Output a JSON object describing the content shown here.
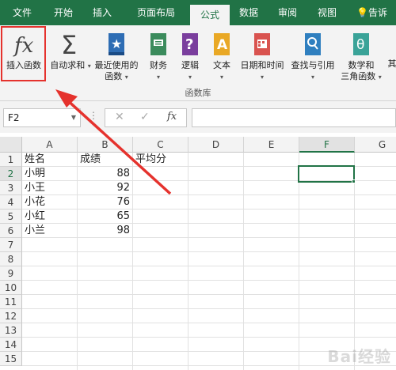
{
  "tabs": [
    {
      "label": "文件"
    },
    {
      "label": "开始"
    },
    {
      "label": "插入"
    },
    {
      "label": "页面布局"
    },
    {
      "label": "公式",
      "active": true
    },
    {
      "label": "数据"
    },
    {
      "label": "审阅"
    },
    {
      "label": "视图"
    },
    {
      "label": "告诉我"
    }
  ],
  "ribbon": {
    "insert_function": {
      "icon": "function-fx-icon",
      "label": "插入函数"
    },
    "autosum": {
      "icon": "sigma-icon",
      "label": "自动求和"
    },
    "recent": {
      "icon": "star-book-icon",
      "label1": "最近使用的",
      "label2": "函数"
    },
    "finance": {
      "icon": "finance-book-icon",
      "label": "财务"
    },
    "logic": {
      "icon": "question-book-icon",
      "label": "逻辑"
    },
    "text": {
      "icon": "text-book-icon",
      "label": "文本"
    },
    "datetime": {
      "icon": "calendar-book-icon",
      "label": "日期和时间"
    },
    "lookup": {
      "icon": "search-book-icon",
      "label": "查找与引用"
    },
    "math": {
      "icon": "theta-book-icon",
      "label1": "数学和",
      "label2": "三角函数"
    },
    "more": {
      "label": "其"
    },
    "group_label": "函数库"
  },
  "formula_bar": {
    "name_box": "F2",
    "cancel": "✕",
    "enter": "✓",
    "fx": "fx",
    "value": ""
  },
  "columns": [
    "A",
    "B",
    "C",
    "D",
    "E",
    "F",
    "G"
  ],
  "rows": [
    "1",
    "2",
    "3",
    "4",
    "5",
    "6",
    "7",
    "8",
    "9",
    "10",
    "11",
    "12",
    "13",
    "14",
    "15"
  ],
  "cells": {
    "a1": "姓名",
    "b1": "成绩",
    "c1": "平均分",
    "a2": "小明",
    "b2": "88",
    "a3": "小王",
    "b3": "92",
    "a4": "小花",
    "b4": "76",
    "a5": "小红",
    "b5": "65",
    "a6": "小兰",
    "b6": "98"
  },
  "selected_cell": "F2",
  "colors": {
    "ribbon": "#217346",
    "highlight": "#e5322d"
  },
  "watermark": "Bai经验"
}
